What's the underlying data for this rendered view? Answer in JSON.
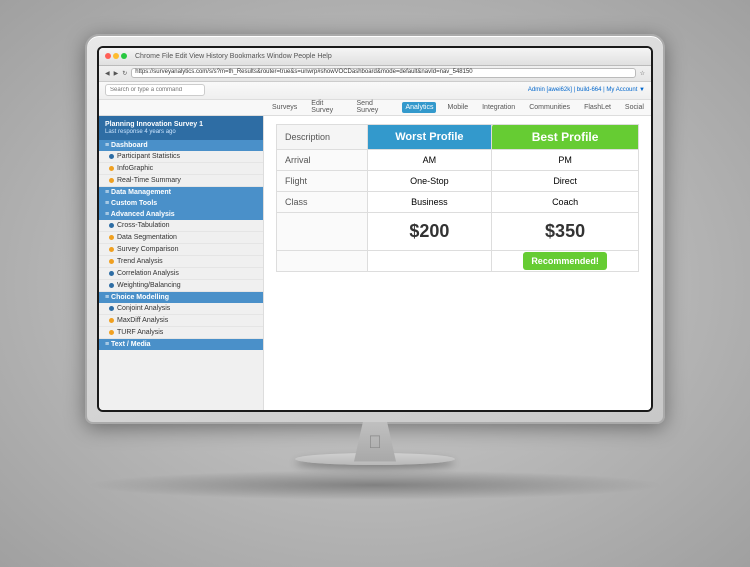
{
  "monitor": {
    "chrome": {
      "title": "Chrome  File  Edit  View  History  Bookmarks  Window  People  Help"
    },
    "address": {
      "url": "https://surveyanalytics.com/s/s?m=th_Results&router=true&s=unwrp#showVOCDashboard&mode=default&navId=nav_548150"
    },
    "nav": {
      "search_placeholder": "Search or type a command",
      "admin_text": "Admin [awei62k] | build-664 | My Account ▼"
    }
  },
  "top_menu": {
    "items": [
      "Surveys",
      "Edit Survey",
      "Send Survey",
      "Analytics",
      "Mobile",
      "Integration",
      "Communities",
      "FlashLet",
      "Social"
    ],
    "active": "Analytics"
  },
  "sidebar": {
    "header": {
      "title": "Planning Innovation Survey 1",
      "subtitle": "Last response 4 years ago"
    },
    "sections": [
      {
        "type": "section",
        "label": "≡ Dashboard"
      },
      {
        "type": "item",
        "label": "Participant Statistics",
        "bullet": "blue"
      },
      {
        "type": "item",
        "label": "InfoGraphic",
        "bullet": "orange"
      },
      {
        "type": "item",
        "label": "Real-Time Summary",
        "bullet": "orange"
      },
      {
        "type": "section",
        "label": "≡ Data Management"
      },
      {
        "type": "section",
        "label": "≡ Custom Tools"
      },
      {
        "type": "section",
        "label": "≡ Advanced Analysis",
        "active": true
      },
      {
        "type": "item",
        "label": "Cross-Tabulation",
        "bullet": "blue"
      },
      {
        "type": "item",
        "label": "Data Segmentation",
        "bullet": "orange"
      },
      {
        "type": "item",
        "label": "Survey Comparison",
        "bullet": "orange"
      },
      {
        "type": "item",
        "label": "Trend Analysis",
        "bullet": "orange"
      },
      {
        "type": "item",
        "label": "Correlation Analysis",
        "bullet": "blue"
      },
      {
        "type": "item",
        "label": "Weighting/Balancing",
        "bullet": "blue"
      },
      {
        "type": "section",
        "label": "≡ Choice Modelling",
        "highlighted": true
      },
      {
        "type": "item",
        "label": "Conjoint Analysis",
        "bullet": "blue"
      },
      {
        "type": "item",
        "label": "MaxDiff Analysis",
        "bullet": "orange"
      },
      {
        "type": "item",
        "label": "TURF Analysis",
        "bullet": "orange"
      },
      {
        "type": "section",
        "label": "≡ Text / Media"
      }
    ]
  },
  "profiles": {
    "headers": {
      "description": "Description",
      "worst": "Worst Profile",
      "best": "Best Profile"
    },
    "rows": [
      {
        "label": "Arrival",
        "worst": "AM",
        "best": "PM"
      },
      {
        "label": "Flight",
        "worst": "One-Stop",
        "best": "Direct"
      },
      {
        "label": "Class",
        "worst": "Business",
        "best": "Coach"
      }
    ],
    "prices": {
      "worst": "$200",
      "best": "$350"
    },
    "recommended_label": "Recommended!"
  }
}
